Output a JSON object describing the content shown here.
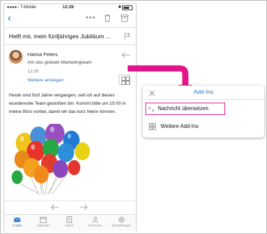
{
  "status_bar": {
    "carrier": "●●●●○ T-Mobile",
    "time": "12:26",
    "bluetooth": "✱"
  },
  "toolbar": {
    "more_label": "•••",
    "icons": [
      "back-icon",
      "more-icon",
      "trash-icon",
      "archive-icon"
    ]
  },
  "subject": "Helft mir, mein fünfjähriges Jubiläum ...",
  "message": {
    "sender": "Hanna Peters",
    "recipient": "Am das globale Marketingteam",
    "time": "12:26",
    "show_more": "Weitere anzeigen",
    "body": "Heute sind fünf Jahre vergangen, seit ich auf dieses wundervolle Team gestoßen bin. Kommt bitte um 15:00 in meine Büro vorbei, damit wir das kurz feiern können."
  },
  "tabs": [
    {
      "label": "E-Mail",
      "icon": "mail-icon",
      "active": true
    },
    {
      "label": "Kalender",
      "icon": "calendar-icon",
      "active": false
    },
    {
      "label": "News",
      "icon": "news-icon",
      "active": false
    },
    {
      "label": "Personen",
      "icon": "people-icon",
      "active": false
    },
    {
      "label": "Einstellungen",
      "icon": "settings-icon",
      "active": false
    }
  ],
  "addins_panel": {
    "title": "Add-Ins",
    "items": [
      {
        "label": "Nachricht übersetzen",
        "icon": "translate-icon",
        "highlighted": true
      },
      {
        "label": "Weitere Add-Ins",
        "icon": "addins-icon",
        "highlighted": false
      }
    ]
  },
  "colors": {
    "accent": "#2a74c8",
    "highlight": "#e0158a"
  }
}
